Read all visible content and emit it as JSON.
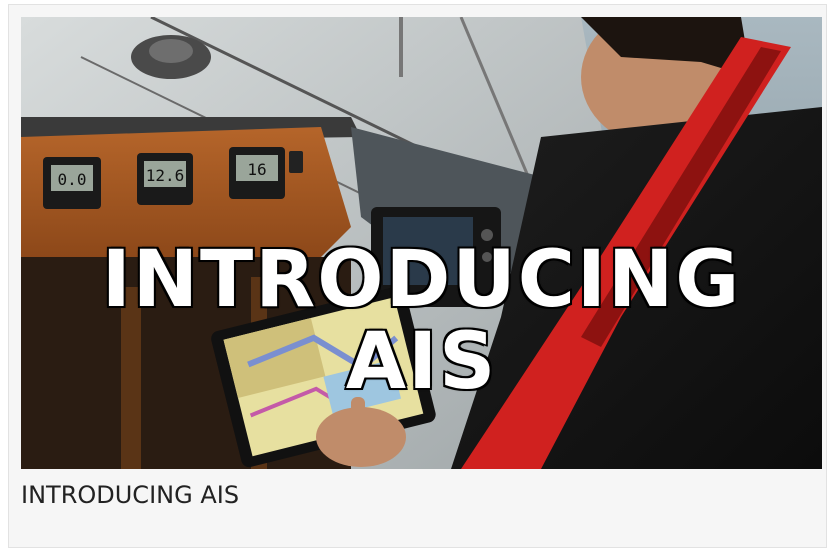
{
  "card": {
    "overlay_line1": "INTRODUCING",
    "overlay_line2": "AIS",
    "caption": "INTRODUCING AIS",
    "instrument_readings": [
      "0.0",
      "12.6",
      "16"
    ]
  },
  "colors": {
    "card_background": "#f6f6f6",
    "caption_text": "#222222",
    "overlay_text": "#ffffff",
    "overlay_outline": "#000000",
    "lifejacket_red": "#d0211f",
    "instrument_panel_wood": "#a65a22"
  }
}
